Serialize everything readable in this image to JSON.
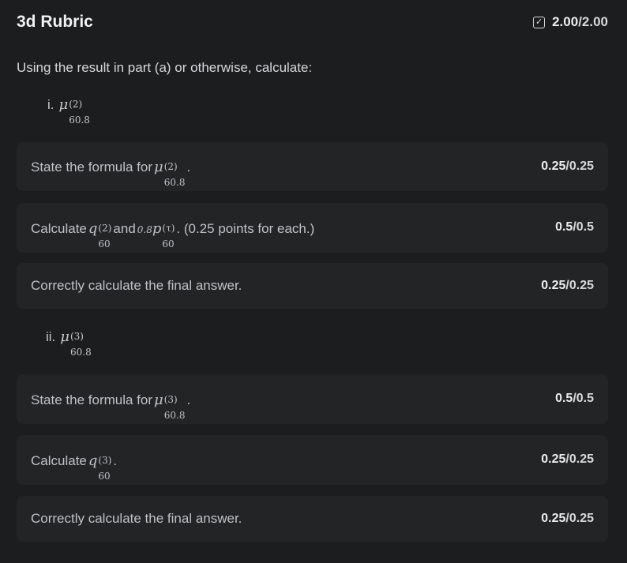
{
  "header": {
    "title": "3d Rubric",
    "score_earned": "2.00",
    "score_max": "/2.00",
    "check_icon": "check-square-icon"
  },
  "question": {
    "prompt": "Using the result in part (a) or otherwise, calculate:",
    "parts": [
      {
        "roman": "i.",
        "symbol": "μ",
        "sup": "(2)",
        "sub": "60.8"
      },
      {
        "roman": "ii.",
        "symbol": "μ",
        "sup": "(3)",
        "sub": "60.8"
      }
    ]
  },
  "criteria": [
    {
      "text_before": "State the formula for",
      "math": {
        "symbol": "μ",
        "sup": "(2)",
        "sub": "60.8"
      },
      "text_after": ".",
      "earned": "0.25",
      "max": "/0.25"
    },
    {
      "text_before": "Calculate",
      "math": {
        "symbol": "q",
        "sup": "(2)",
        "sub": "60"
      },
      "text_mid": "and",
      "math2": {
        "pre": "0.8",
        "symbol": "p",
        "sup": "(τ)",
        "sub": "60"
      },
      "text_after": ". (0.25 points for each.)",
      "earned": "0.5",
      "max": "/0.5"
    },
    {
      "text_before": "Correctly calculate the final answer.",
      "earned": "0.25",
      "max": "/0.25"
    },
    {
      "text_before": "State the formula for",
      "math": {
        "symbol": "μ",
        "sup": "(3)",
        "sub": "60.8"
      },
      "text_after": ".",
      "earned": "0.5",
      "max": "/0.5"
    },
    {
      "text_before": "Calculate",
      "math": {
        "symbol": "q",
        "sup": "(3)",
        "sub": "60"
      },
      "text_after": ".",
      "earned": "0.25",
      "max": "/0.25"
    },
    {
      "text_before": "Correctly calculate the final answer.",
      "earned": "0.25",
      "max": "/0.25"
    }
  ]
}
